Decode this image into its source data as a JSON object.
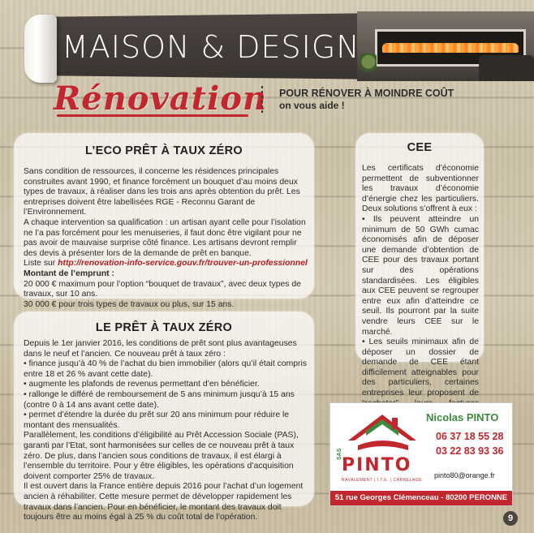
{
  "header": {
    "magazine_title": "MAISON & DESIGN",
    "section_title": "Rénovation",
    "tagline_main": "POUR RÉNOVER À MOINDRE COÛT",
    "tagline_sub": "on vous aide !"
  },
  "eco_pret": {
    "title": "L’ECO PRÊT À TAUX ZÉRO",
    "p1": "Sans condition de ressources, il concerne les résidences principales construites avant 1990, et finance forcément un bouquet d’au moins deux types de travaux, à réaliser dans les trois ans après obtention du prêt. Les entreprises doivent être labellisées RGE - Reconnu Garant de l’Environnement.",
    "p2": "A chaque intervention sa qualification : un artisan ayant celle pour l’isolation ne l’a pas forcément pour les menuiseries, il faut donc être vigilant pour ne pas avoir de mauvaise surprise côté finance. Les artisans devront remplir des devis à présenter lors de la demande de prêt en banque.",
    "link_prefix": "Liste sur ",
    "link": "http://renovation-info-service.gouv.fr/trouver-un-professionnel",
    "amount_heading": "Montant de l’emprunt :",
    "amount1": "20 000 € maximum pour l’option “bouquet de travaux”, avec deux types de travaux, sur 10 ans.",
    "amount2": "30 000 € pour trois types de travaux ou plus, sur 15 ans."
  },
  "ptz": {
    "title": "LE PRÊT À TAUX ZÉRO",
    "intro": "Depuis le 1er janvier 2016, les conditions de prêt sont plus avantageuses dans le neuf et l’ancien. Ce nouveau prêt à taux zéro :",
    "bullets": [
      "• finance jusqu’à 40 % de l’achat du bien immobilier (alors qu’il était compris entre 18 et 26 % avant cette date).",
      "• augmente les plafonds de revenus permettant d’en bénéficier.",
      "• rallonge le différé de remboursement de 5 ans minimum jusqu’à 15 ans (contre 0 à 14 ans avant cette date).",
      "• permet d’étendre la durée du prêt sur 20 ans minimum pour réduire le montant des mensualités."
    ],
    "p2": "Parallèlement, les conditions d’éligibilité au Prêt Accession Sociale (PAS), garanti par l’Etat, sont harmonisées sur celles de ce nouveau prêt à taux zéro. De plus, dans l’ancien sous conditions de travaux, il est élargi à l’ensemble du territoire. Pour y être éligibles, les opérations d’acquisition doivent comporter 25% de travaux.",
    "p3": "Il est ouvert dans la France entière depuis 2016 pour l’achat d’un logement ancien à réhabiliter. Cette mesure permet de développer rapidement les travaux dans l’ancien. Pour en bénéficier, le montant des travaux doit toujours être au moins égal à 25 % du coût total de l’opération."
  },
  "cee": {
    "title": "CEE",
    "p1": "Les certificats d’économie permettent de subventionner les travaux d’économie d’énergie chez les particuliers. Deux solutions s’offrent à eux :",
    "b1": "• Ils peuvent atteindre un minimum de 50 GWh cumac économisés afin de déposer une demande d’obtention de CEE pour des travaux portant sur des opérations standardisées. Les éligibles aux CEE peuvent se regrouper entre eux afin d’atteindre ce seuil. Ils pourront par la suite vendre leurs CEE sur le marché.",
    "b2": "• Les seuils minimaux afin de déposer un dossier de demande de CEE étant difficilement atteignables pour des particuliers, certaines entreprises leur proposent de “racheter” leurs factures d’économie d’énergie pouvant aller jusqu’à plusieurs centaines d’euros pour leurs travaux d’économie d’énergie."
  },
  "ad": {
    "sas": "SAS",
    "brand": "PINTO",
    "trades": "RAVALEMENT | I.T.E. | CARRELAGE",
    "contact_name": "Nicolas PINTO",
    "phone1": "06 37 18 55 28",
    "phone2": "03 22 83 93 36",
    "email": "pinto80@orange.fr",
    "address": "51 rue Georges Clémenceau - 80200 PERONNE",
    "colors": {
      "brand_red": "#c2272d",
      "brand_green": "#3b8a3f"
    }
  },
  "page_number": "9"
}
